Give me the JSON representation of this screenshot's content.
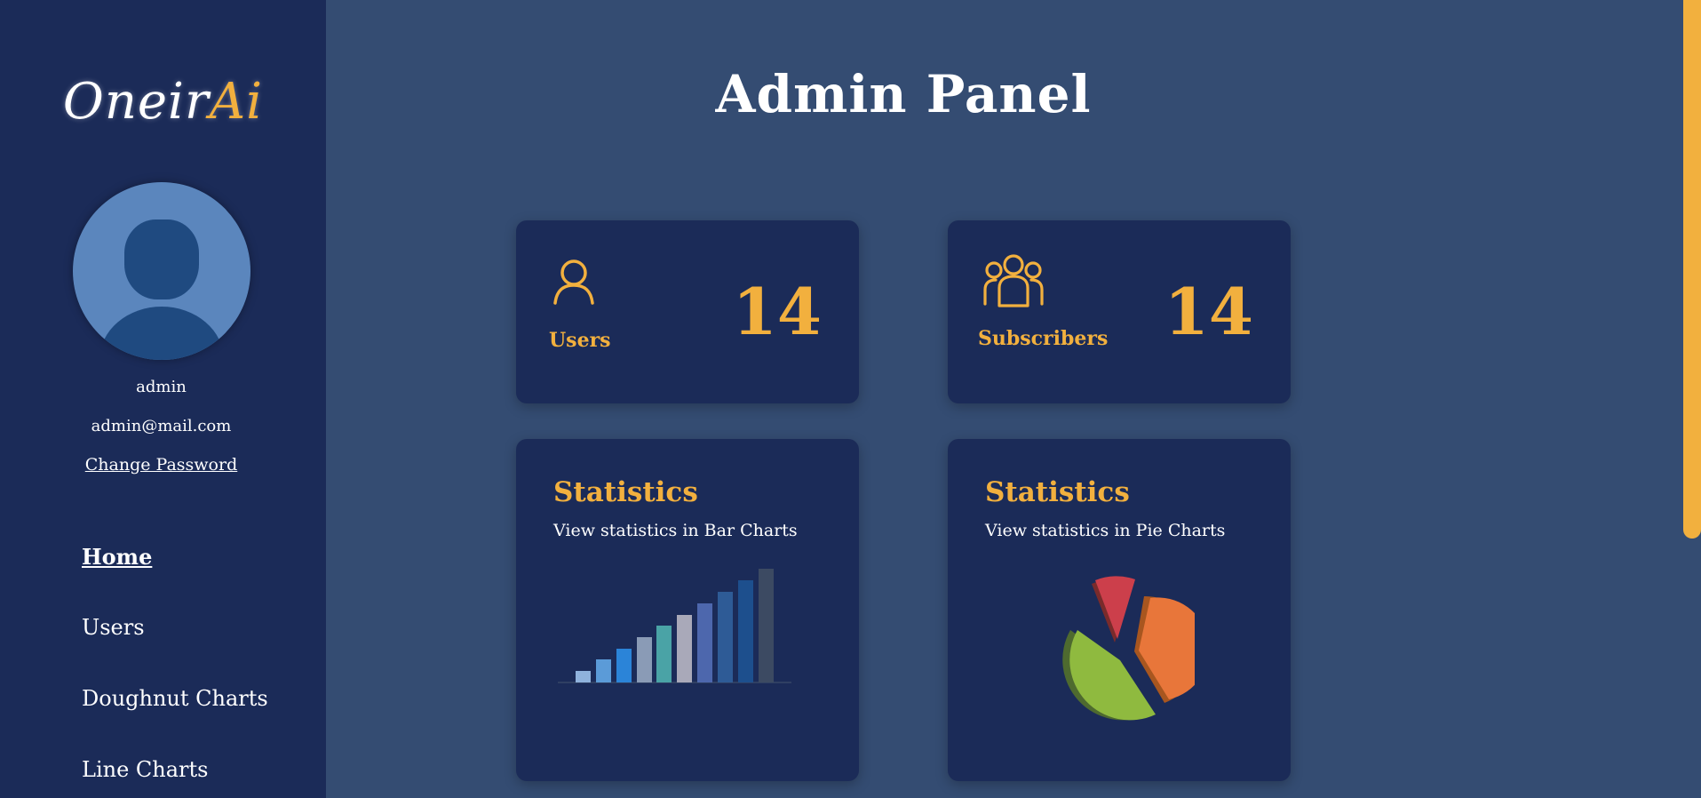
{
  "sidebar": {
    "logo_part1": "Oneir",
    "logo_part2": "Ai",
    "username": "admin",
    "email": "admin@mail.com",
    "change_password": "Change Password",
    "nav": [
      {
        "label": "Home",
        "active": true
      },
      {
        "label": "Users"
      },
      {
        "label": "Doughnut Charts"
      },
      {
        "label": "Line Charts"
      }
    ]
  },
  "main": {
    "title": "Admin Panel",
    "users_card": {
      "label": "Users",
      "value": "14",
      "icon": "user-icon"
    },
    "subscribers_card": {
      "label": "Subscribers",
      "value": "14",
      "icon": "users-group-icon"
    },
    "bar_card": {
      "title": "Statistics",
      "subtitle": "View statistics in Bar Charts",
      "illustration": "bar-chart-illustration"
    },
    "pie_card": {
      "title": "Statistics",
      "subtitle": "View statistics in Pie Charts",
      "illustration": "pie-chart-illustration"
    }
  },
  "colors": {
    "background": "#344c72",
    "sidebar": "#1b2b58",
    "card": "#1b2b58",
    "accent": "#f2b03e",
    "avatar": "#5b86bd"
  }
}
